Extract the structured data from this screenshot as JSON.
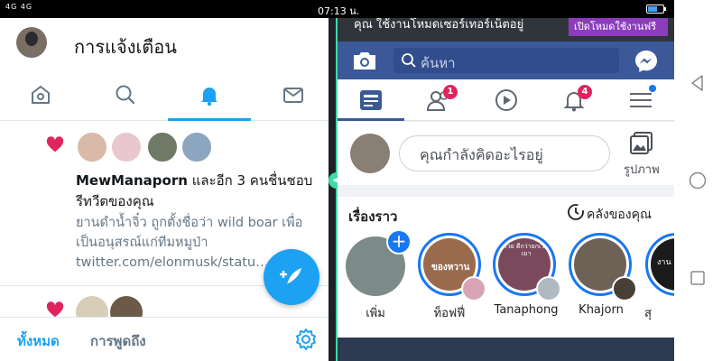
{
  "status_bar": {
    "signal": "4G 4G",
    "time": "07:13 น."
  },
  "twitter": {
    "title": "การแจ้งเตือน",
    "tabs": [
      "home",
      "search",
      "notifications",
      "messages"
    ],
    "notification": {
      "user": "MewManaporn",
      "text": " และอีก 3 คนชื่นชอบรีทวีตของคุณ",
      "quote": "ยานดำน้ำจิ๋ว ถูกตั้งชื่อว่า wild boar เพื่อเป็นอนุสรณ์แก่ทีมหมูป่า twitter.com/elonmusk/statu…"
    },
    "bottom": {
      "all": "ทั้งหมด",
      "mentions": "การพูดถึง"
    }
  },
  "facebook": {
    "ad_text": "คุณ ใช้งานโหมดเซอร์เทอร์เน็ตอยู่",
    "ad_button": "เปิดโหมดใช้งานฟรี",
    "search_placeholder": "ค้นหา",
    "friend_badge": "1",
    "notif_badge": "4",
    "composer_placeholder": "คุณกำลังคิดอะไรอยู่",
    "photo_label": "รูปภาพ",
    "stories_title": "เรื่องราว",
    "archive_label": "คลังของคุณ",
    "stories": [
      {
        "name": "เพิ่ม"
      },
      {
        "name": "ท็อฟฟี่",
        "overlay": "ของหวาน"
      },
      {
        "name": "Tanaphong",
        "overlay": "รวย ดีกว่ายกเว้นเมา"
      },
      {
        "name": "Khajorn"
      },
      {
        "name": "สุ",
        "overlay": "งาน"
      }
    ]
  },
  "colors": {
    "twitter_blue": "#1da1f2",
    "facebook_blue": "#3b5998",
    "split_green": "#3ddca6"
  }
}
